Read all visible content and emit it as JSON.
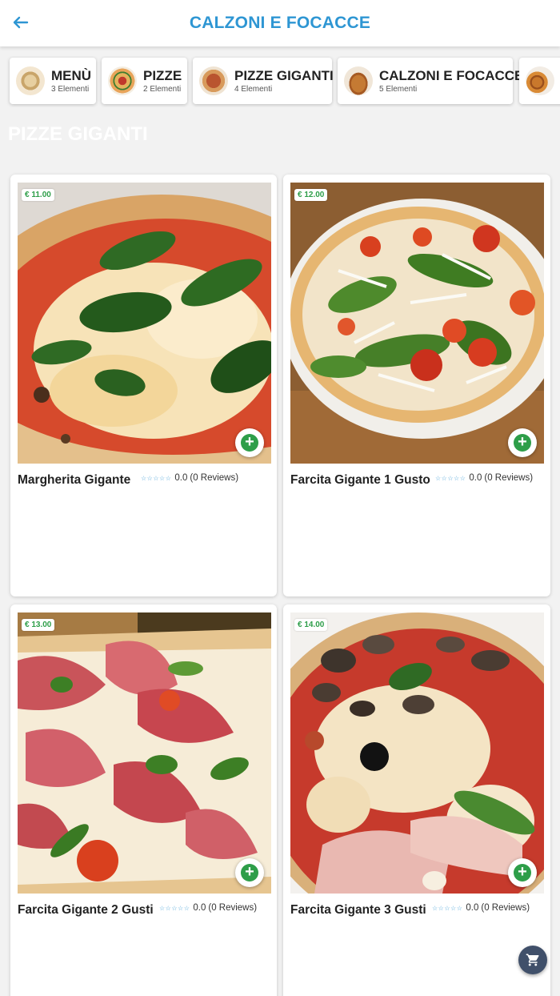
{
  "header": {
    "title": "CALZONI E FOCACCE",
    "back_icon": "arrow-left-icon",
    "accent": "#2e96d3"
  },
  "categories": [
    {
      "name": "MENÙ",
      "count": "3 Elementi"
    },
    {
      "name": "PIZZE",
      "count": "2 Elementi"
    },
    {
      "name": "PIZZE GIGANTI",
      "count": "4 Elementi"
    },
    {
      "name": "CALZONI E FOCACCE",
      "count": "5 Elementi"
    }
  ],
  "section_title": "PIZZE GIGANTI",
  "products": [
    {
      "price": "€ 11.00",
      "name": "Margherita Gigante",
      "stars": "☆☆☆☆☆",
      "rating": "0.0",
      "reviews": "(0 Reviews)"
    },
    {
      "price": "€ 12.00",
      "name": "Farcita Gigante 1 Gusto",
      "stars": "☆☆☆☆☆",
      "rating": "0.0",
      "reviews": "(0 Reviews)"
    },
    {
      "price": "€ 13.00",
      "name": "Farcita Gigante 2 Gusti",
      "stars": "☆☆☆☆☆",
      "rating": "0.0",
      "reviews": "(0 Reviews)"
    },
    {
      "price": "€ 14.00",
      "name": "Farcita Gigante 3 Gusti",
      "stars": "☆☆☆☆☆",
      "rating": "0.0",
      "reviews": "(0 Reviews)"
    }
  ],
  "add_icon": "plus-circle-icon",
  "cart_icon": "shopping-cart-icon",
  "colors": {
    "price_green": "#2e9e49",
    "star_blue": "#4aa3d8",
    "cart_bg": "#40506a"
  }
}
